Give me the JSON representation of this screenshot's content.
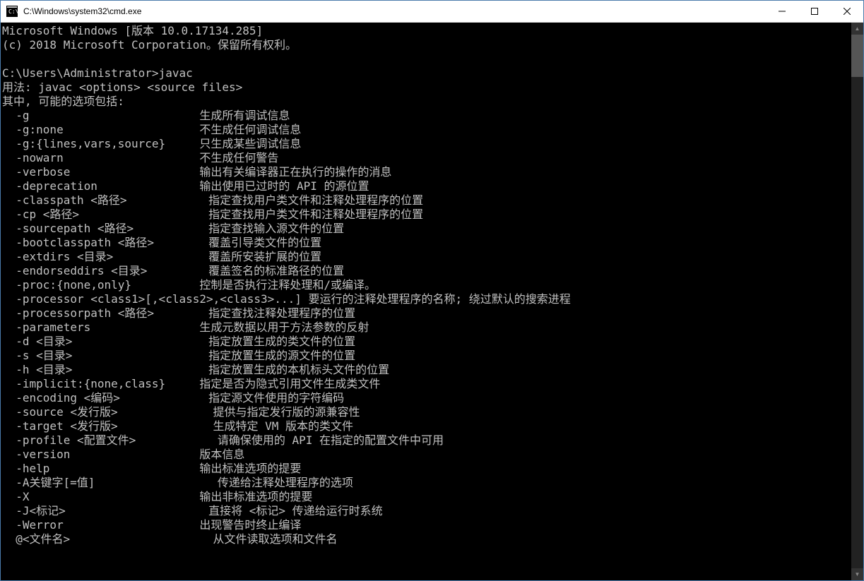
{
  "titlebar": {
    "title": "C:\\Windows\\system32\\cmd.exe"
  },
  "console": {
    "header1": "Microsoft Windows [版本 10.0.17134.285]",
    "header2": "(c) 2018 Microsoft Corporation。保留所有权利。",
    "blank": "",
    "prompt": "C:\\Users\\Administrator>javac",
    "usage": "用法: javac <options> <source files>",
    "where": "其中, 可能的选项包括:",
    "opt_g": "  -g                         生成所有调试信息",
    "opt_gnone": "  -g:none                    不生成任何调试信息",
    "opt_glines": "  -g:{lines,vars,source}     只生成某些调试信息",
    "opt_nowarn": "  -nowarn                    不生成任何警告",
    "opt_verbose": "  -verbose                   输出有关编译器正在执行的操作的消息",
    "opt_deprecation": "  -deprecation               输出使用已过时的 API 的源位置",
    "opt_classpath": "  -classpath <路径>            指定查找用户类文件和注释处理程序的位置",
    "opt_cp": "  -cp <路径>                   指定查找用户类文件和注释处理程序的位置",
    "opt_sourcepath": "  -sourcepath <路径>           指定查找输入源文件的位置",
    "opt_bootclasspath": "  -bootclasspath <路径>        覆盖引导类文件的位置",
    "opt_extdirs": "  -extdirs <目录>              覆盖所安装扩展的位置",
    "opt_endorseddirs": "  -endorseddirs <目录>         覆盖签名的标准路径的位置",
    "opt_proc": "  -proc:{none,only}          控制是否执行注释处理和/或编译。",
    "opt_processor": "  -processor <class1>[,<class2>,<class3>...] 要运行的注释处理程序的名称; 绕过默认的搜索进程",
    "opt_processorpath": "  -processorpath <路径>        指定查找注释处理程序的位置",
    "opt_parameters": "  -parameters                生成元数据以用于方法参数的反射",
    "opt_d": "  -d <目录>                    指定放置生成的类文件的位置",
    "opt_s": "  -s <目录>                    指定放置生成的源文件的位置",
    "opt_h": "  -h <目录>                    指定放置生成的本机标头文件的位置",
    "opt_implicit": "  -implicit:{none,class}     指定是否为隐式引用文件生成类文件",
    "opt_encoding": "  -encoding <编码>             指定源文件使用的字符编码",
    "opt_source": "  -source <发行版>              提供与指定发行版的源兼容性",
    "opt_target": "  -target <发行版>              生成特定 VM 版本的类文件",
    "opt_profile": "  -profile <配置文件>            请确保使用的 API 在指定的配置文件中可用",
    "opt_version": "  -version                   版本信息",
    "opt_help": "  -help                      输出标准选项的提要",
    "opt_A": "  -A关键字[=值]                  传递给注释处理程序的选项",
    "opt_X": "  -X                         输出非标准选项的提要",
    "opt_J": "  -J<标记>                     直接将 <标记> 传递给运行时系统",
    "opt_Werror": "  -Werror                    出现警告时终止编译",
    "opt_atfile": "  @<文件名>                     从文件读取选项和文件名"
  }
}
